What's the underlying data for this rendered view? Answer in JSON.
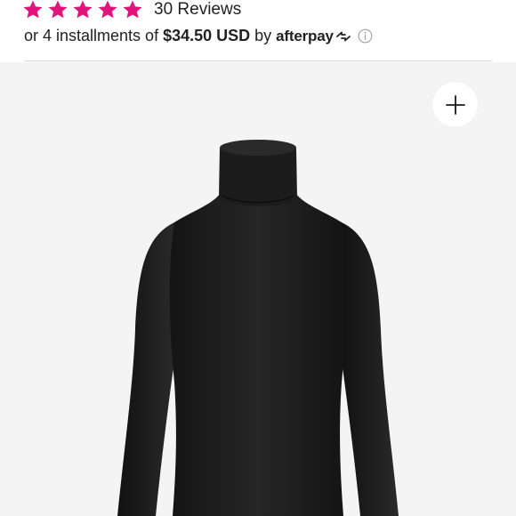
{
  "rating": {
    "stars": 5,
    "star_color": "#e0147a",
    "reviews_label": "30 Reviews"
  },
  "installments": {
    "prefix": "or 4 installments of",
    "amount": "$34.50 USD",
    "by": "by",
    "provider": "afterpay",
    "info_icon": "info-icon"
  },
  "gallery": {
    "image_alt": "Black long-sleeve turtleneck bodysuit",
    "zoom_icon": "plus-icon"
  },
  "colors": {
    "text": "#222222",
    "divider": "#d9d9d9",
    "image_background": "#f4f4f4"
  }
}
